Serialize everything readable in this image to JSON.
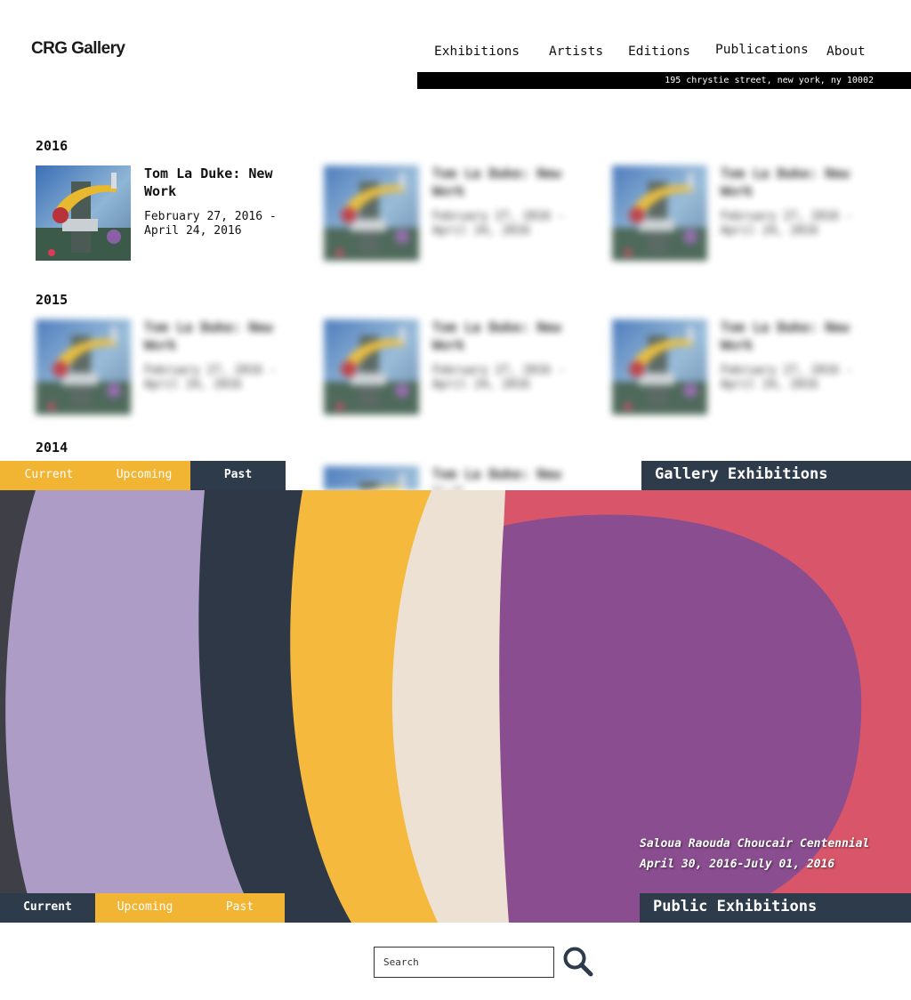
{
  "header": {
    "logo": "CRG Gallery",
    "nav": [
      "Exhibitions",
      "Artists",
      "Editions",
      "Publications",
      "About"
    ],
    "address": "195 chrystie street, new york, ny 10002"
  },
  "years": [
    "2016",
    "2015",
    "2014"
  ],
  "featured": {
    "title": "Tom La Duke: New Work",
    "dates": "February 27, 2016 - April 24, 2016"
  },
  "gallery_tabs": {
    "labels": [
      "Current",
      "Upcoming",
      "Past"
    ],
    "active": "Past",
    "section": "Gallery Exhibitions"
  },
  "hero_caption": {
    "title": "Saloua Raouda Choucair Centennial",
    "dates": "April 30, 2016-July 01, 2016"
  },
  "public_tabs": {
    "labels": [
      "Current",
      "Upcoming",
      "Past"
    ],
    "active": "Current",
    "section": "Public Exhibitions"
  },
  "search": {
    "placeholder": "Search"
  },
  "colors": {
    "tab_yellow": "#f2b533",
    "tab_dark": "#2d3b4b",
    "address_bar": "#000000"
  },
  "icons": {
    "search": "magnifier-icon"
  }
}
